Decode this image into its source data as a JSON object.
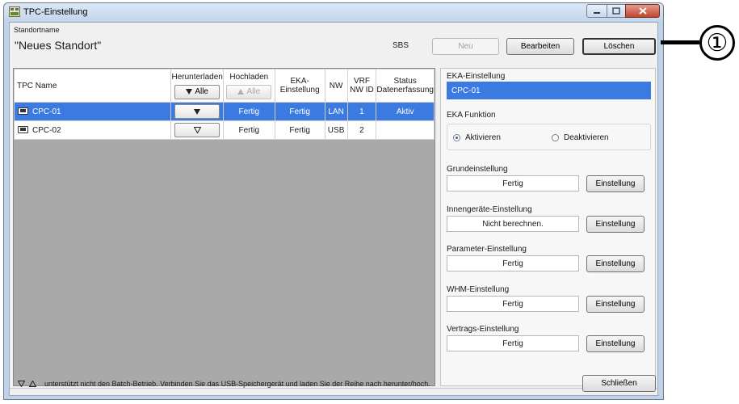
{
  "window": {
    "title": "TPC-Einstellung",
    "min_icon": "minimize-icon",
    "max_icon": "maximize-icon",
    "close_icon": "close-icon"
  },
  "site": {
    "label": "Standortname",
    "name": "\"Neues Standort\""
  },
  "header": {
    "sbs_label": "SBS",
    "new_label": "Neu",
    "edit_label": "Bearbeiten",
    "delete_label": "Löschen"
  },
  "table": {
    "col_name": "TPC Name",
    "col_download": "Herunterladen",
    "col_upload": "Hochladen",
    "col_eka": "EKA-Einstellung",
    "col_nw": "NW",
    "col_vrf": "VRF NW ID",
    "col_status": "Status Datenerfassung",
    "download_all": "Alle",
    "upload_all": "Alle",
    "rows": [
      {
        "name": "CPC-01",
        "upload": "Fertig",
        "eka": "Fertig",
        "nw": "LAN",
        "vrf": "1",
        "status": "Aktiv",
        "selected": true
      },
      {
        "name": "CPC-02",
        "upload": "Fertig",
        "eka": "Fertig",
        "nw": "USB",
        "vrf": "2",
        "status": "",
        "selected": false
      }
    ]
  },
  "panel": {
    "eka_label": "EKA-Einstellung",
    "eka_value": "CPC-01",
    "func_label": "EKA Funktion",
    "activate": "Aktivieren",
    "deactivate": "Deaktivieren",
    "activated": true,
    "settings": [
      {
        "label": "Grundeinstellung",
        "value": "Fertig",
        "button": "Einstellung"
      },
      {
        "label": "Innengeräte-Einstellung",
        "value": "Nicht berechnen.",
        "button": "Einstellung"
      },
      {
        "label": "Parameter-Einstellung",
        "value": "Fertig",
        "button": "Einstellung"
      },
      {
        "label": "WHM-Einstellung",
        "value": "Fertig",
        "button": "Einstellung"
      },
      {
        "label": "Vertrags-Einstellung",
        "value": "Fertig",
        "button": "Einstellung"
      }
    ]
  },
  "footer": {
    "note": "unterstützt nicht den Batch-Betrieb. Verbinden Sie das USB-Speichergerät und laden Sie der Reihe nach herunter/hoch.",
    "close_label": "Schließen"
  },
  "callout": {
    "number": "①"
  }
}
